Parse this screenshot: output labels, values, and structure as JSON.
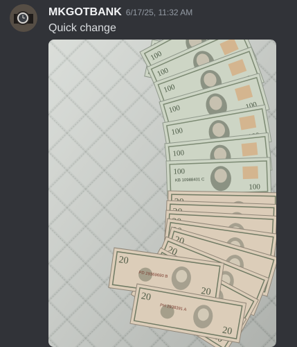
{
  "message": {
    "author": "MKGOTBANK",
    "timestamp": "6/17/25, 11:32 AM",
    "text": "Quick change",
    "avatar_icon": "watch-avatar-icon",
    "attachment": {
      "type": "photo",
      "subject": "cash-on-quilt",
      "banknotes": [
        {
          "denomination": "100",
          "serials": [
            "KB 10988401 C"
          ]
        },
        {
          "denomination": "20",
          "serials": [
            "PD 29369690 B",
            "PH 2938391 A"
          ]
        }
      ]
    }
  },
  "colors": {
    "background": "#313338",
    "username": "#f2f3f5",
    "timestamp": "#949ba4",
    "message_text": "#dbdee1",
    "quilt": "#c8cdc9",
    "bill_green": "#c9d2bb",
    "bill_tint_20": "#d9c9b8"
  }
}
